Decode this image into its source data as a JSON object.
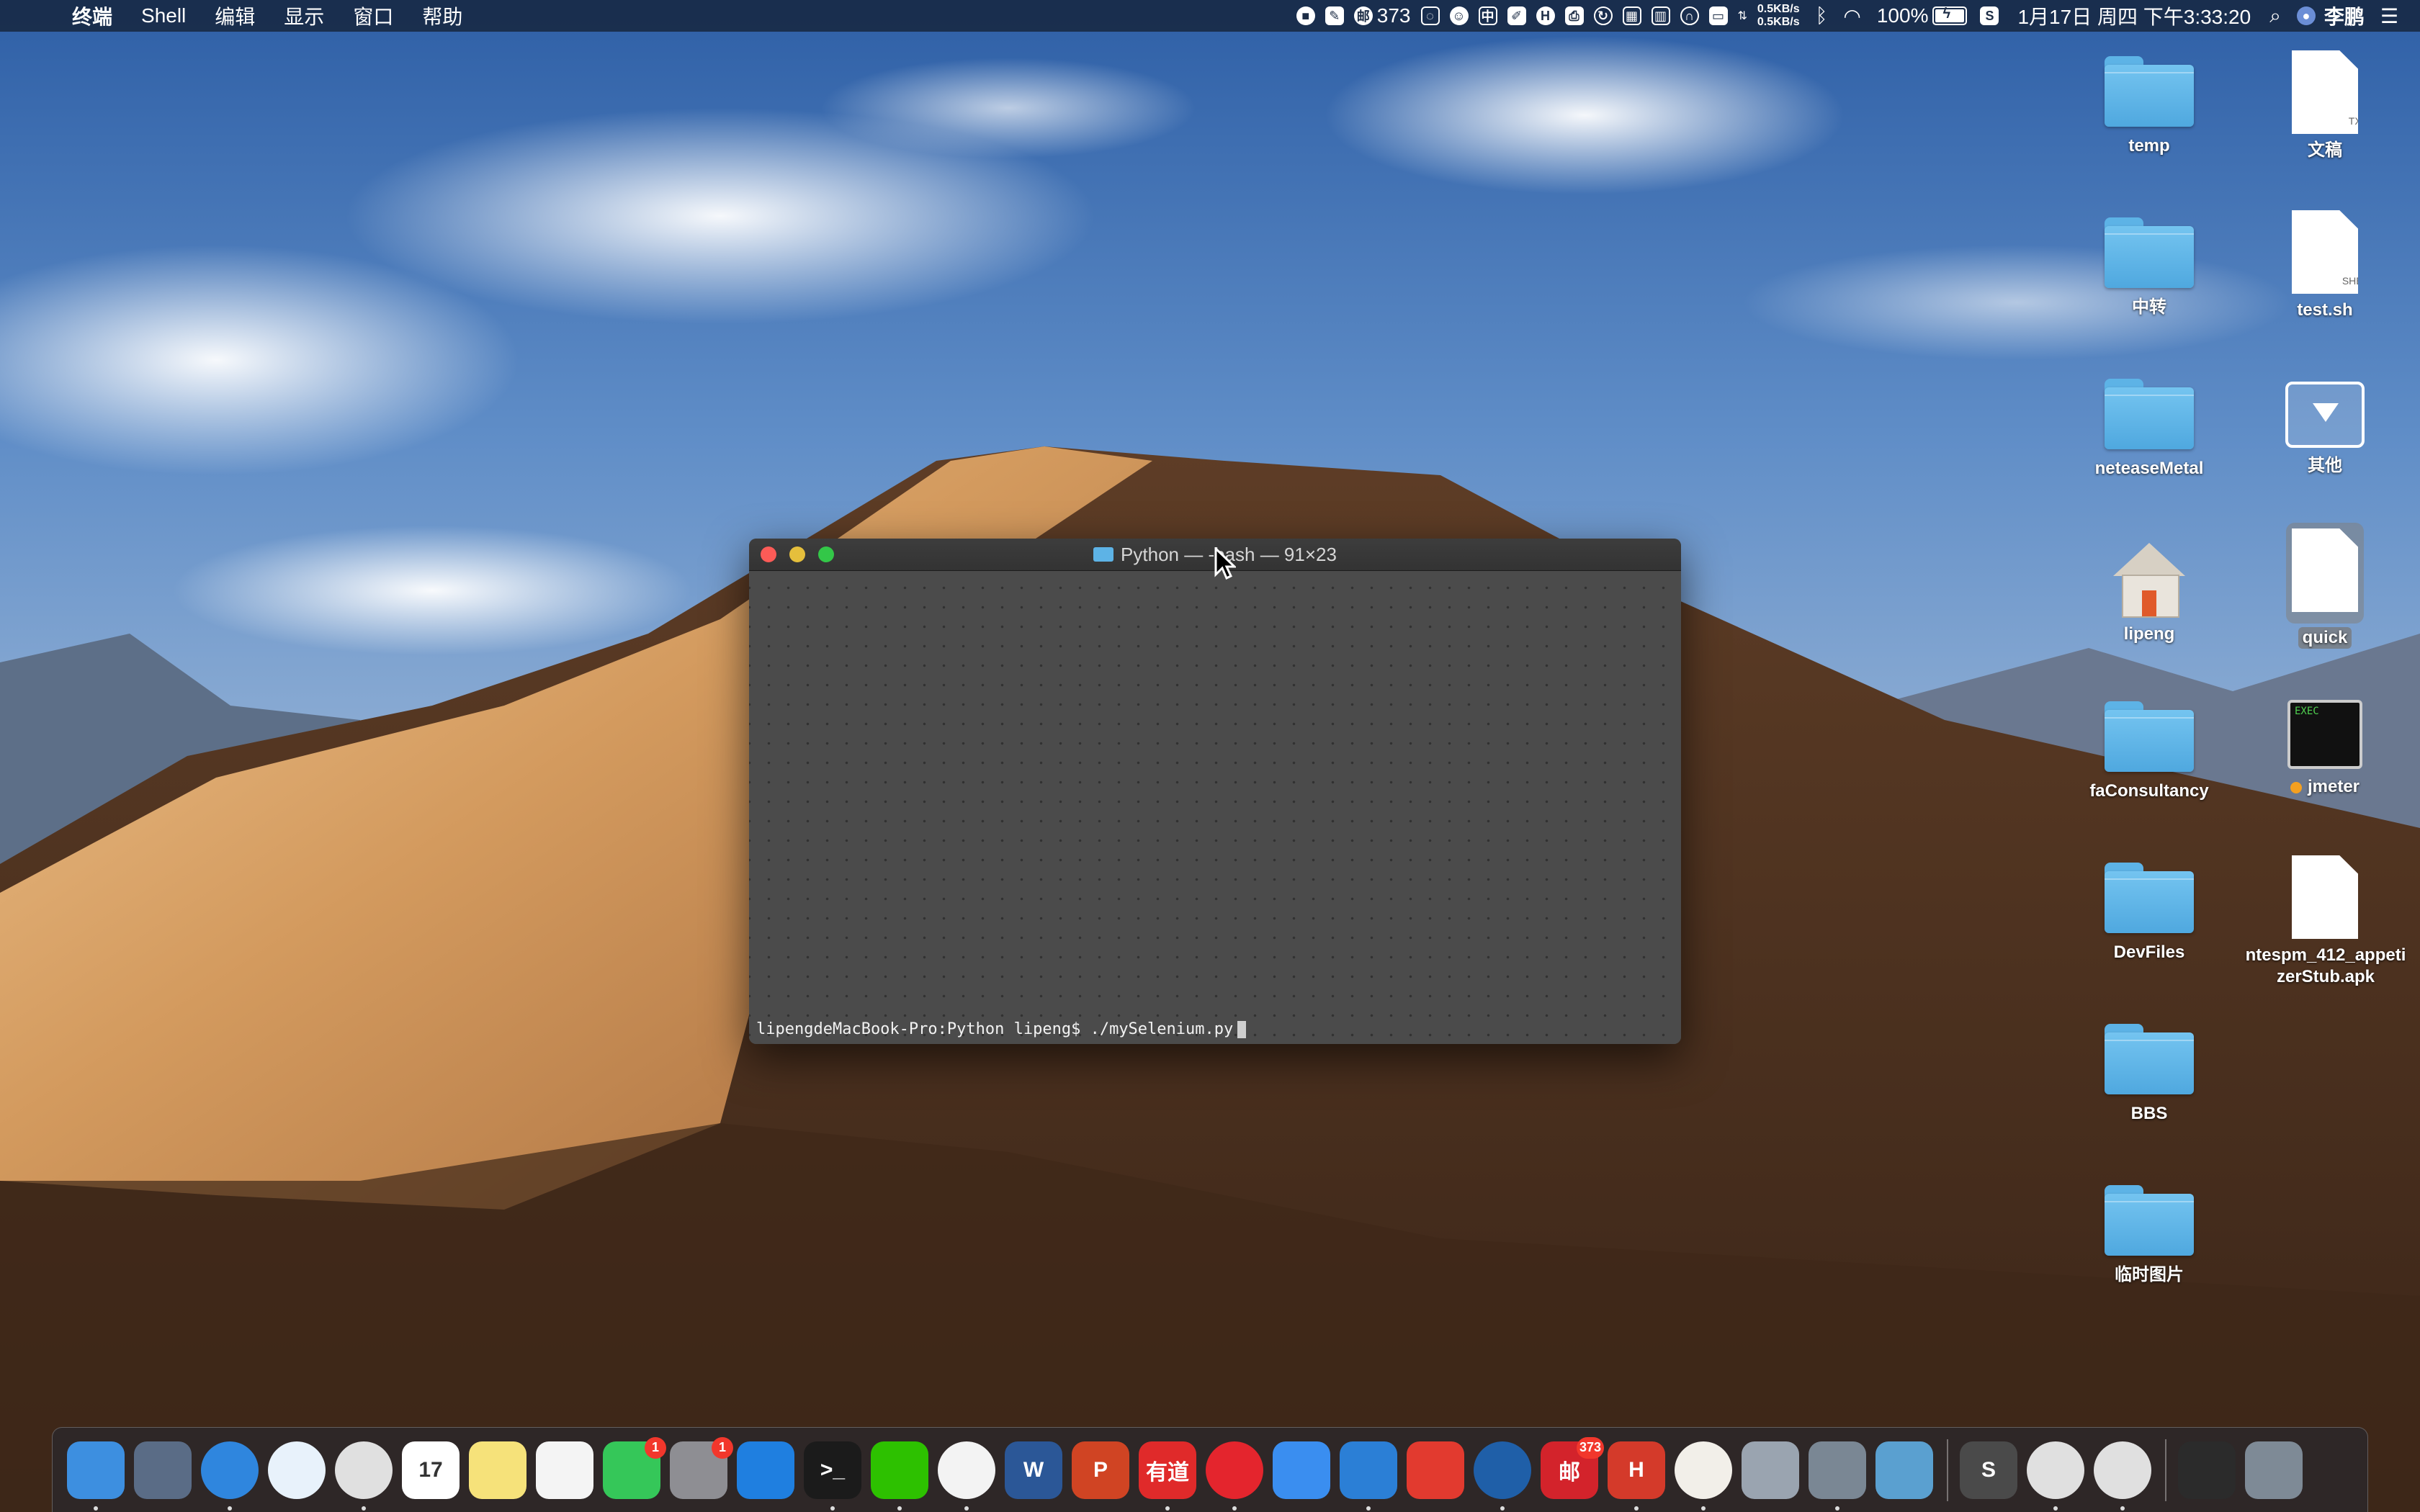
{
  "menubar": {
    "app_name": "终端",
    "menus": [
      "Shell",
      "编辑",
      "显示",
      "窗口",
      "帮助"
    ],
    "status": {
      "notification_count": "373",
      "input_method": "中",
      "net_up": "0.5KB/s",
      "net_down": "0.5KB/s",
      "battery_percent": "100%",
      "datetime": "1月17日 周四 下午3:33:20",
      "user_name": "李鹏"
    }
  },
  "desktop": {
    "icons": [
      {
        "label": "temp"
      },
      {
        "label": "文稿",
        "ext": "TXT"
      },
      {
        "label": "中转"
      },
      {
        "label": "test.sh",
        "ext": "SHELL"
      },
      {
        "label": "neteaseMetal"
      },
      {
        "label": "其他"
      },
      {
        "label": "lipeng"
      },
      {
        "label": "quick"
      },
      {
        "label": "faConsultancy"
      },
      {
        "label": "jmeter",
        "thumb_text": "EXEC"
      },
      {
        "label": "DevFiles"
      },
      {
        "label": "ntespm_412_appetizerStub.apk"
      },
      {
        "label": "BBS"
      },
      {
        "label": "临时图片"
      }
    ]
  },
  "terminal": {
    "title": "Python — -bash — 91×23",
    "prompt": "lipengdeMacBook-Pro:Python lipeng$ ./mySelenium.py"
  },
  "dock": {
    "items": [
      {
        "name": "finder-icon",
        "color": "#3d8fe0"
      },
      {
        "name": "launchpad-icon",
        "color": "#5a6c86"
      },
      {
        "name": "safari-icon",
        "color": "#2f86de"
      },
      {
        "name": "sync-icon",
        "color": "#e8f2fb"
      },
      {
        "name": "chrome-icon",
        "color": "#e0e0e0"
      },
      {
        "name": "calendar-icon",
        "color": "#ffffff",
        "text": "17"
      },
      {
        "name": "notes-icon",
        "color": "#f6e27a"
      },
      {
        "name": "reminders-icon",
        "color": "#f4f4f4"
      },
      {
        "name": "facetime-icon",
        "color": "#35c759",
        "badge": "1"
      },
      {
        "name": "system-preferences-icon",
        "color": "#8e8e93",
        "badge": "1"
      },
      {
        "name": "xcode-icon",
        "color": "#1f7fe0"
      },
      {
        "name": "terminal-icon",
        "color": "#1b1b1b",
        "text": ">_"
      },
      {
        "name": "wechat-icon",
        "color": "#2dc100"
      },
      {
        "name": "qq-icon",
        "color": "#f3f3f3"
      },
      {
        "name": "word-icon",
        "color": "#2b5797",
        "text": "W"
      },
      {
        "name": "powerpoint-icon",
        "color": "#d04423",
        "text": "P"
      },
      {
        "name": "youdao-icon",
        "color": "#e02a2a",
        "text": "有道"
      },
      {
        "name": "netease-music-icon",
        "color": "#e4252d"
      },
      {
        "name": "feather-icon",
        "color": "#3a8ef0"
      },
      {
        "name": "simulator-icon",
        "color": "#2b7fd6"
      },
      {
        "name": "xmind-icon",
        "color": "#e23a2f"
      },
      {
        "name": "proxy-icon",
        "color": "#1f5fa8"
      },
      {
        "name": "mail-app-icon",
        "color": "#d3232b",
        "text": "邮",
        "badge": "373"
      },
      {
        "name": "h-app-icon",
        "color": "#d43a2a",
        "text": "H"
      },
      {
        "name": "jenkins-icon",
        "color": "#f2efe9"
      },
      {
        "name": "database-icon",
        "color": "#9aa4b0"
      },
      {
        "name": "screenshot-tool-icon",
        "color": "#7a8794"
      },
      {
        "name": "preview-icon",
        "color": "#5aa0d0"
      },
      {
        "name": "sublime-icon",
        "color": "#4a4a4a",
        "text": "S"
      },
      {
        "name": "chrome-icon-2",
        "color": "#e0e0e0"
      },
      {
        "name": "chrome-icon-3",
        "color": "#e0e0e0"
      },
      {
        "name": "downloads-stack-icon",
        "color": "#2b2b2b"
      },
      {
        "name": "trash-icon",
        "color": "#7e8a96"
      }
    ]
  }
}
